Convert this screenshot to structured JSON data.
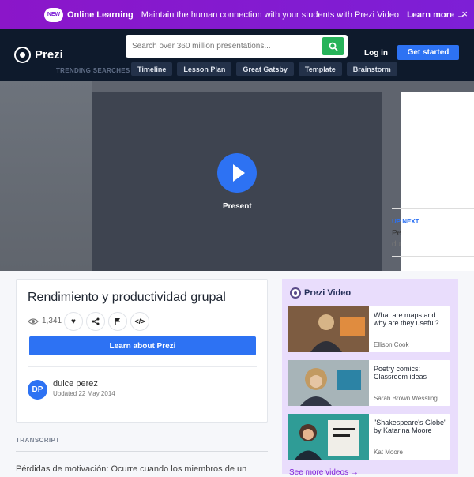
{
  "banner": {
    "badge": "NEW",
    "title": "Online Learning",
    "message": "Maintain the human connection with your students with Prezi Video",
    "cta": "Learn more →",
    "close": "×"
  },
  "header": {
    "logo": "Prezi",
    "search_placeholder": "Search over 360 million presentations...",
    "login": "Log in",
    "get_started": "Get started",
    "trending_label": "TRENDING SEARCHES",
    "trending": [
      "Timeline",
      "Lesson Plan",
      "Great Gatsby",
      "Template",
      "Brainstorm"
    ]
  },
  "player": {
    "present": "Present",
    "side": {
      "upnext": "UP NEXT",
      "title_1": "Pe",
      "title_2": "du"
    }
  },
  "presentation": {
    "title": "Rendimiento y productividad grupal",
    "views": "1,341",
    "learn_button": "Learn about Prezi",
    "author_initials": "DP",
    "author": "dulce perez",
    "updated": "Updated 22 May 2014"
  },
  "transcript": {
    "label": "TRANSCRIPT",
    "text": "Pérdidas de motivación: Ocurre cuando los miembros de un"
  },
  "prezi_video": {
    "title": "Prezi Video",
    "items": [
      {
        "title": "What are maps and why are they useful?",
        "author": "Ellison Cook"
      },
      {
        "title": "Poetry comics: Classroom ideas",
        "author": "Sarah Brown Wessling"
      },
      {
        "title": "\"Shakespeare's Globe\" by Katarina Moore",
        "author": "Kat Moore"
      }
    ],
    "see_more": "See more videos →"
  },
  "colors": {
    "banner": "#7d1fd6",
    "header": "#0e1a2c",
    "primary": "#2d72f3",
    "search_button": "#27b35a",
    "video_panel": "#e9ddfc"
  }
}
